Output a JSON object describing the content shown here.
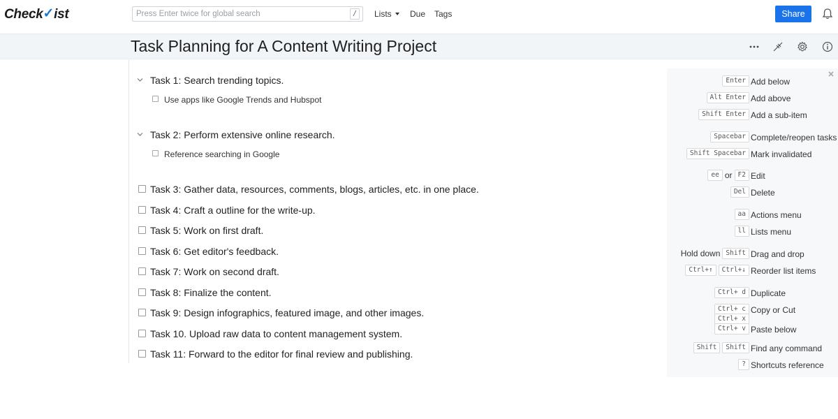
{
  "header": {
    "logo_text_a": "Check",
    "logo_text_b": "ist",
    "search_placeholder": "Press Enter twice for global search",
    "search_shortcut": "/",
    "nav_lists": "Lists",
    "nav_due": "Due",
    "nav_tags": "Tags",
    "share_label": "Share",
    "accent_color": "#1a73e8"
  },
  "title": "Task Planning for A Content Writing Project",
  "tasks": [
    {
      "text": "Task 1: Search trending topics.",
      "expanded": true,
      "subtask": "Use apps like Google Trends and Hubspot"
    },
    {
      "text": "Task 2: Perform extensive online research.",
      "expanded": true,
      "subtask": "Reference searching in Google"
    },
    {
      "text": "Task 3: Gather data, resources, comments, blogs, articles, etc. in one place."
    },
    {
      "text": "Task 4: Craft a outline for the write-up."
    },
    {
      "text": "Task 5: Work on first draft."
    },
    {
      "text": "Task 6: Get editor's feedback."
    },
    {
      "text": "Task 7: Work on second draft."
    },
    {
      "text": "Task 8: Finalize the content."
    },
    {
      "text": "Task 9: Design infographics, featured image, and other images."
    },
    {
      "text": "Task 10. Upload raw data to content management system."
    },
    {
      "text": "Task 11: Forward to the editor for final review and publishing."
    }
  ],
  "shortcuts": {
    "add_below": {
      "keys": [
        "Enter"
      ],
      "action": "Add below"
    },
    "add_above": {
      "keys": [
        "Alt Enter"
      ],
      "action": "Add above"
    },
    "add_subitem": {
      "keys": [
        "Shift Enter"
      ],
      "action": "Add a sub-item"
    },
    "complete": {
      "keys": [
        "Spacebar"
      ],
      "action": "Complete/reopen tasks"
    },
    "invalidate": {
      "keys": [
        "Shift Spacebar"
      ],
      "action": "Mark invalidated"
    },
    "edit": {
      "keys": [
        "ee",
        "F2"
      ],
      "joiner": "or",
      "action": "Edit"
    },
    "delete": {
      "keys": [
        "Del"
      ],
      "action": "Delete"
    },
    "actions_menu": {
      "keys": [
        "aa"
      ],
      "action": "Actions menu"
    },
    "lists_menu": {
      "keys": [
        "ll"
      ],
      "action": "Lists menu"
    },
    "drag": {
      "prefix": "Hold down",
      "keys": [
        "Shift"
      ],
      "action": "Drag and drop"
    },
    "reorder": {
      "keys": [
        "Ctrl+↑",
        "Ctrl+↓"
      ],
      "action": "Reorder list items"
    },
    "duplicate": {
      "keys": [
        "Ctrl+ d"
      ],
      "action": "Duplicate"
    },
    "copy_cut": {
      "keys": [
        "Ctrl+ c",
        "Ctrl+ x"
      ],
      "action": "Copy or Cut"
    },
    "paste": {
      "keys": [
        "Ctrl+ v"
      ],
      "action": "Paste below"
    },
    "find": {
      "keys": [
        "Shift",
        "Shift"
      ],
      "action": "Find any command"
    },
    "reference": {
      "keys": [
        "?"
      ],
      "action": "Shortcuts reference"
    }
  }
}
